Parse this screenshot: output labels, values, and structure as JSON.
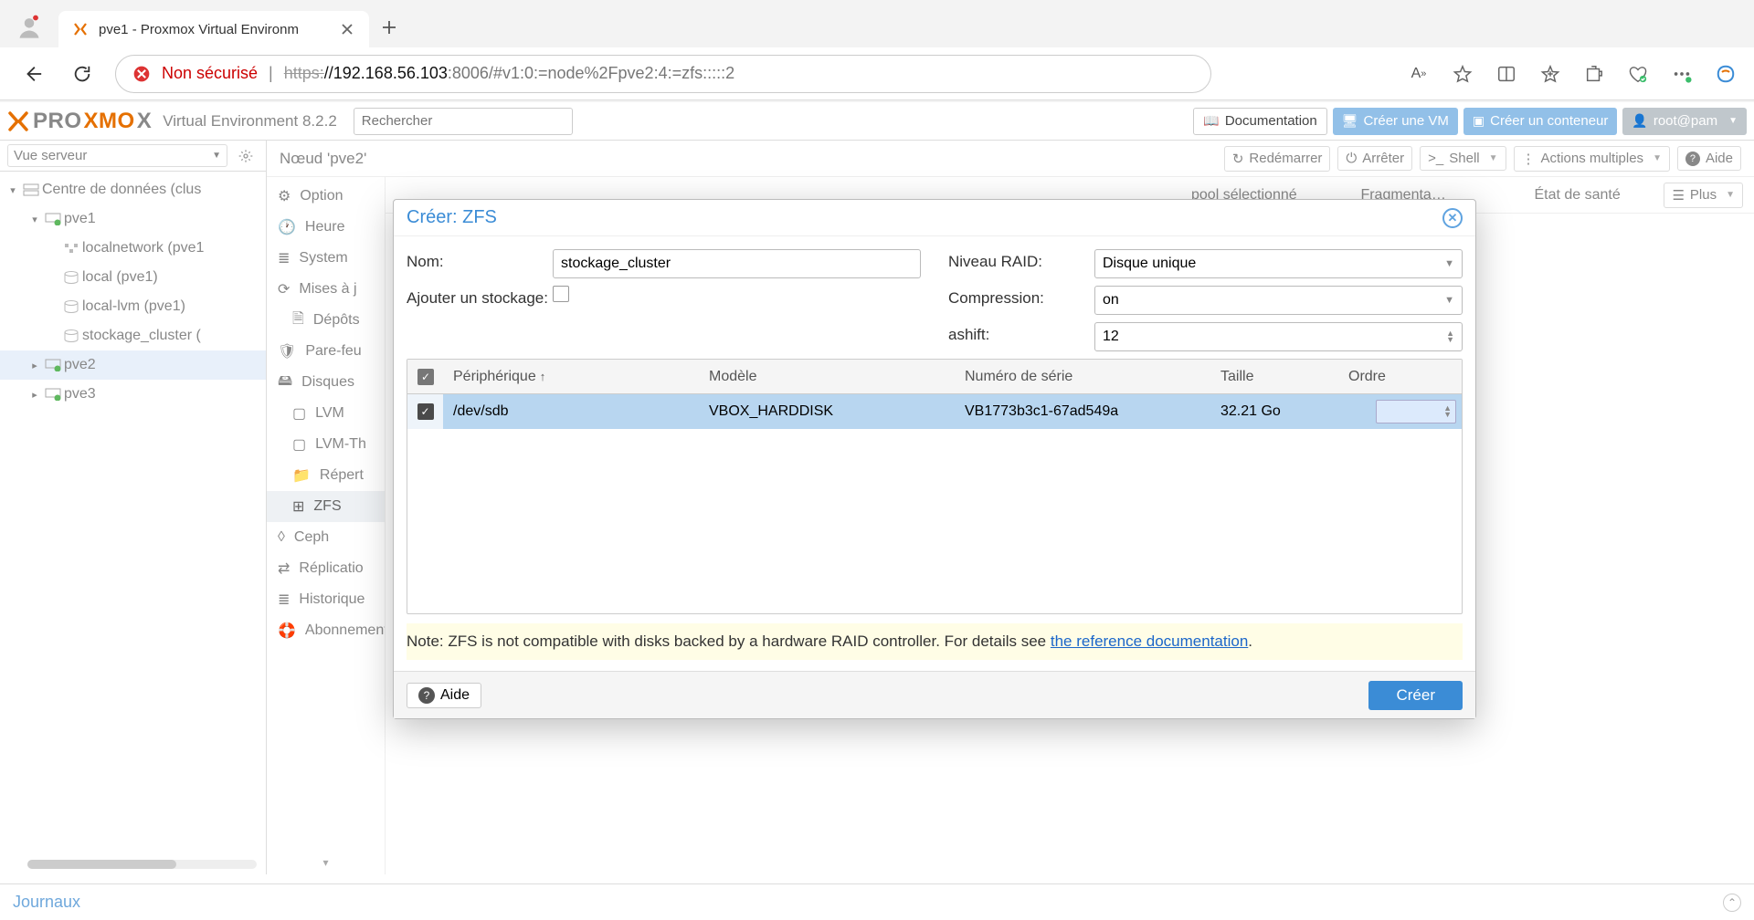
{
  "browser": {
    "tab_title": "pve1 - Proxmox Virtual Environm",
    "not_secure": "Non sécurisé",
    "url_https": "https:",
    "url_host": "//192.168.56.103",
    "url_rest": ":8006/#v1:0:=node%2Fpve2:4:=zfs:::::2"
  },
  "header": {
    "env": "Virtual Environment 8.2.2",
    "search_placeholder": "Rechercher",
    "documentation": "Documentation",
    "create_vm": "Créer une VM",
    "create_ct": "Créer un conteneur",
    "user": "root@pam"
  },
  "tree": {
    "view_label": "Vue serveur",
    "datacenter": "Centre de données (clus",
    "pve1": "pve1",
    "localnetwork": "localnetwork (pve1",
    "local": "local (pve1)",
    "locallvm": "local-lvm (pve1)",
    "stockage": "stockage_cluster (",
    "pve2": "pve2",
    "pve3": "pve3"
  },
  "crumb": "Nœud 'pve2'",
  "toolbar": {
    "restart": "Redémarrer",
    "stop": "Arrêter",
    "shell": "Shell",
    "bulk": "Actions multiples",
    "help": "Aide"
  },
  "menu": {
    "options": "Option",
    "time": "Heure",
    "syslog": "System",
    "updates": "Mises à j",
    "repos": "Dépôts",
    "firewall": "Pare-feu",
    "disks": "Disques",
    "lvm": "LVM",
    "lvmthin": "LVM-Th",
    "dir": "Répert",
    "zfs": "ZFS",
    "ceph": "Ceph",
    "replication": "Réplicatio",
    "tasks": "Historique",
    "subscription": "Abonnement"
  },
  "detail": {
    "col_pool": "pool sélectionné",
    "col_frag": "Fragmenta…",
    "col_health": "État de santé",
    "plus": "Plus"
  },
  "modal": {
    "title": "Créer: ZFS",
    "lbl_name": "Nom:",
    "val_name": "stockage_cluster",
    "lbl_addstorage": "Ajouter un stockage:",
    "lbl_raid": "Niveau RAID:",
    "val_raid": "Disque unique",
    "lbl_compression": "Compression:",
    "val_compression": "on",
    "lbl_ashift": "ashift:",
    "val_ashift": "12",
    "col_device": "Périphérique",
    "col_model": "Modèle",
    "col_serial": "Numéro de série",
    "col_size": "Taille",
    "col_order": "Ordre",
    "row_device": "/dev/sdb",
    "row_model": "VBOX_HARDDISK",
    "row_serial": "VB1773b3c1-67ad549a",
    "row_size": "32.21 Go",
    "note_pre": "Note: ZFS is not compatible with disks backed by a hardware RAID controller. For details see ",
    "note_link": "the reference documentation",
    "note_post": ".",
    "help": "Aide",
    "create": "Créer"
  },
  "footer": {
    "logs": "Journaux"
  }
}
